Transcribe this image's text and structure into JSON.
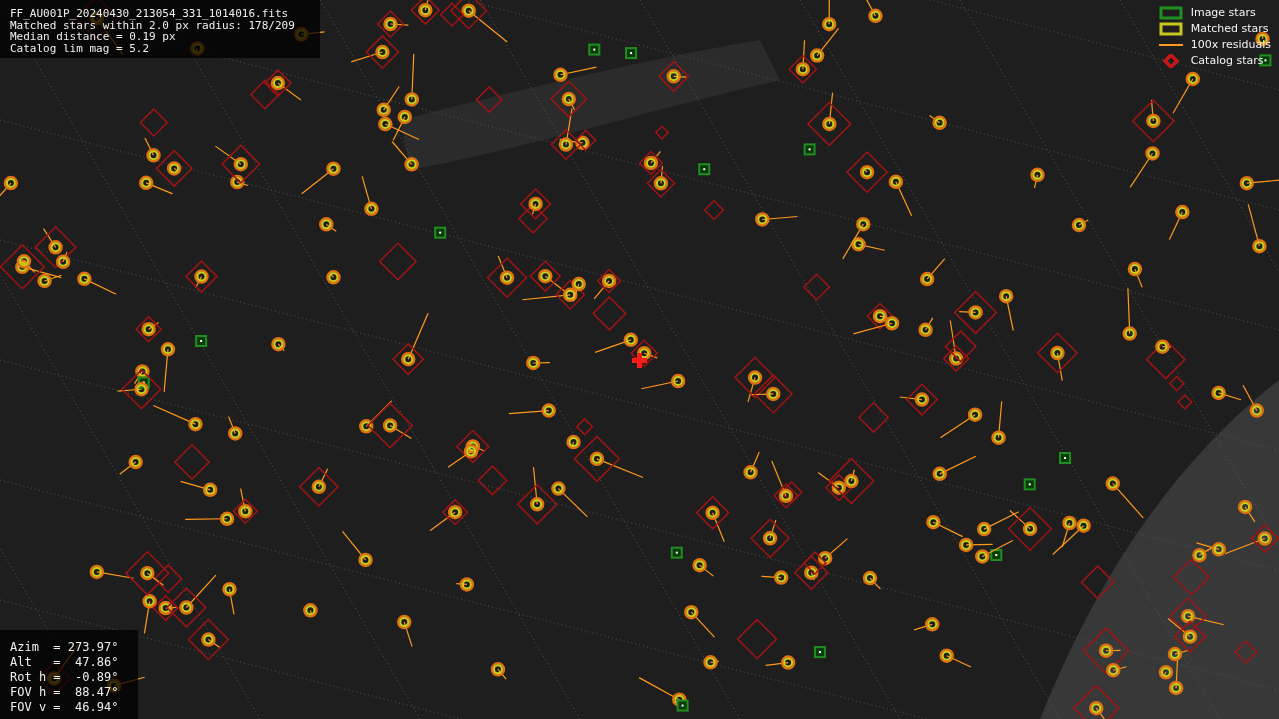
{
  "info_lines": [
    "FF_AU001P_20240430_213054_331_1014016.fits",
    "Matched stars within 2.0 px radius: 178/209",
    "Median distance = 0.19 px",
    "Catalog lim mag = 5.2"
  ],
  "legend": [
    {
      "kind": "box",
      "color": "#1f8f1f",
      "label": "Image stars"
    },
    {
      "kind": "box",
      "color": "#c8c820",
      "label": "Matched stars"
    },
    {
      "kind": "line",
      "color": "#ff9a1a",
      "label": "100x residuals"
    },
    {
      "kind": "diamond",
      "color": "#c01818",
      "label": "Catalog stars"
    }
  ],
  "pointing": [
    "Azim  = 273.97°",
    "Alt   =  47.86°",
    "Rot h =  -0.89°",
    "FOV h =  88.47°",
    "FOV v =  46.94°"
  ]
}
